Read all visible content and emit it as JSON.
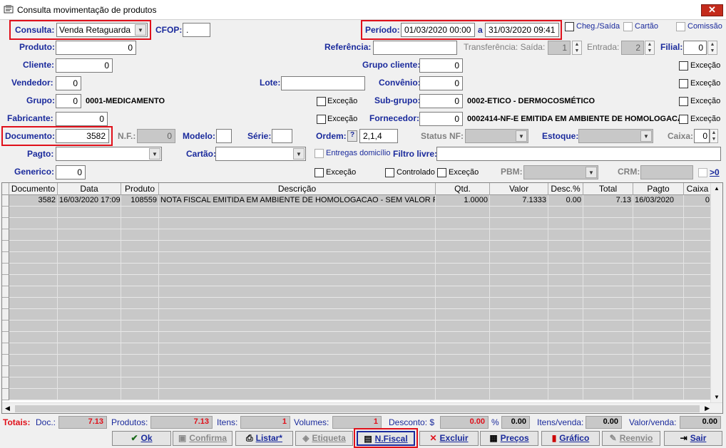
{
  "window": {
    "title": "Consulta movimentação de produtos",
    "close": "✕"
  },
  "form": {
    "consulta_label": "Consulta:",
    "consulta_value": "Venda Retaguarda",
    "cfop_label": "CFOP:",
    "cfop_value": ".",
    "periodo_label": "Período:",
    "periodo_from": "01/03/2020 00:00",
    "periodo_sep": "a",
    "periodo_to": "31/03/2020 09:41",
    "cheg_saida": "Cheg./Saída",
    "cartao_chk": "Cartão",
    "comissao": "Comissão",
    "produto_label": "Produto:",
    "produto_value": "0",
    "referencia_label": "Referência:",
    "referencia_value": "",
    "transferencia_label": "Transferência: Saída:",
    "transf_saida": "1",
    "entrada_label": "Entrada:",
    "entrada_value": "2",
    "filial_label": "Filial:",
    "filial_value": "0",
    "cliente_label": "Cliente:",
    "cliente_value": "0",
    "grupo_cliente_label": "Grupo cliente:",
    "grupo_cliente_value": "0",
    "excecao": "Exceção",
    "vendedor_label": "Vendedor:",
    "vendedor_value": "0",
    "lote_label": "Lote:",
    "lote_value": "",
    "convenio_label": "Convênio:",
    "convenio_value": "0",
    "grupo_label": "Grupo:",
    "grupo_value": "0",
    "grupo_desc": "0001-MEDICAMENTO",
    "subgrupo_label": "Sub-grupo:",
    "subgrupo_value": "0",
    "subgrupo_desc": "0002-ETICO - DERMOCOSMÉTICO",
    "fabricante_label": "Fabricante:",
    "fabricante_value": "0",
    "fornecedor_label": "Fornecedor:",
    "fornecedor_value": "0",
    "fornecedor_desc": "0002414-NF-E EMITIDA EM AMBIENTE DE HOMOLOGACA",
    "documento_label": "Documento:",
    "documento_value": "3582",
    "nf_label": "N.F.:",
    "nf_value": "0",
    "modelo_label": "Modelo:",
    "modelo_value": "",
    "serie_label": "Série:",
    "serie_value": "",
    "ordem_label": "Ordem:",
    "ordem_help": "?",
    "ordem_value": "2,1,4",
    "status_nf_label": "Status NF:",
    "estoque_label": "Estoque:",
    "caixa_label": "Caixa:",
    "caixa_value": "0",
    "pagto_label": "Pagto:",
    "cartao_label": "Cartão:",
    "entregas": "Entregas domicílio",
    "filtro_label": "Filtro livre:",
    "filtro_value": "",
    "generico_label": "Generico:",
    "generico_value": "0",
    "controlado": "Controlado",
    "pbm_label": "PBM:",
    "crm_label": "CRM:",
    "gt0": ">0"
  },
  "grid": {
    "columns": [
      "Documento",
      "Data",
      "Produto",
      "Descrição",
      "Qtd.",
      "Valor",
      "Desc.%",
      "Total",
      "Pagto",
      "Caixa"
    ],
    "rows": [
      [
        "3582",
        "16/03/2020 17:09",
        "108559",
        "NOTA FISCAL EMITIDA EM AMBIENTE DE HOMOLOGACAO - SEM VALOR FISCAL",
        "1.0000",
        "7.1333",
        "0.00",
        "7.13",
        "16/03/2020",
        "0"
      ]
    ]
  },
  "totals": {
    "totais": "Totais:",
    "doc_label": "Doc.:",
    "doc": "7.13",
    "produtos_label": "Produtos:",
    "produtos": "7.13",
    "itens_label": "Itens:",
    "itens": "1",
    "volumes_label": "Volumes:",
    "volumes": "1",
    "desconto_label": "Desconto: $",
    "desconto": "0.00",
    "pct_label": "%",
    "pct": "0.00",
    "itens_venda_label": "Itens/venda:",
    "itens_venda": "0.00",
    "valor_venda_label": "Valor/venda:",
    "valor_venda": "0.00"
  },
  "buttons": {
    "ok": "Ok",
    "confirma": "Confirma",
    "listar": "Listar*",
    "etiqueta": "Etiqueta",
    "nfiscal": "N.Fiscal",
    "excluir": "Excluir",
    "precos": "Preços",
    "grafico": "Gráfico",
    "reenvio": "Reenvio",
    "sair": "Sair"
  },
  "colors": {
    "label": "#1a2a9c",
    "highlight": "#e0101a",
    "disabled": "#c8c8c8"
  }
}
